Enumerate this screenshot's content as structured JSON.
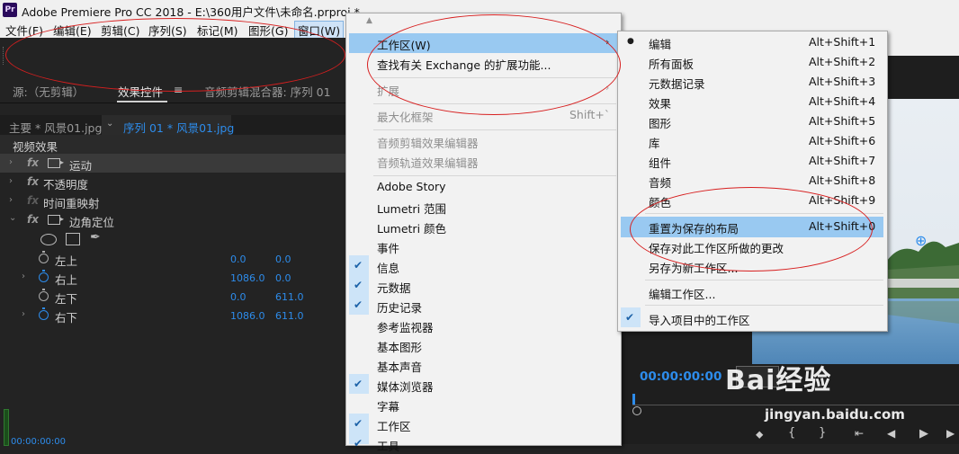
{
  "app": {
    "logo": "Pr",
    "title": "Adobe Premiere Pro CC 2018 - E:\\360用户文件\\未命名.prproj *"
  },
  "menubar": [
    {
      "label": "文件(F)"
    },
    {
      "label": "编辑(E)"
    },
    {
      "label": "剪辑(C)"
    },
    {
      "label": "序列(S)"
    },
    {
      "label": "标记(M)"
    },
    {
      "label": "图形(G)"
    },
    {
      "label": "窗口(W)"
    }
  ],
  "panel_tabs": {
    "source": "源:（无剪辑）",
    "effect_controls": "效果控件",
    "menu_glyph": "≡",
    "audio_mixer": "音频剪辑混合器: 序列 01"
  },
  "sequence_bar": {
    "master": "主要 * 风景01.jpg",
    "sequence": "序列 01 * 风景01.jpg"
  },
  "effects_panel": {
    "section": "视频效果",
    "effects": [
      {
        "label": "运动"
      },
      {
        "label": "不透明度"
      },
      {
        "label": "时间重映射"
      },
      {
        "label": "边角定位"
      }
    ],
    "params": [
      {
        "label": "左上",
        "v1": "0.0",
        "v2": "0.0"
      },
      {
        "label": "右上",
        "v1": "1086.0",
        "v2": "0.0"
      },
      {
        "label": "左下",
        "v1": "0.0",
        "v2": "611.0"
      },
      {
        "label": "右下",
        "v1": "1086.0",
        "v2": "611.0"
      }
    ],
    "bottom_timecode": "00:00:00:00"
  },
  "window_menu": {
    "items": [
      {
        "label": "工作区(W)",
        "state": "highlighted"
      },
      {
        "label": "查找有关 Exchange 的扩展功能..."
      },
      {
        "label": "扩展",
        "state": "disabled"
      },
      {
        "label": "最大化框架",
        "state": "disabled",
        "shortcut": "Shift+`"
      },
      {
        "label": "音频剪辑效果编辑器",
        "state": "disabled"
      },
      {
        "label": "音频轨道效果编辑器",
        "state": "disabled"
      },
      {
        "label": "Adobe Story"
      },
      {
        "label": "Lumetri 范围"
      },
      {
        "label": "Lumetri 颜色"
      },
      {
        "label": "事件"
      },
      {
        "label": "信息",
        "checked": true
      },
      {
        "label": "元数据",
        "checked": true
      },
      {
        "label": "历史记录",
        "checked": true
      },
      {
        "label": "参考监视器"
      },
      {
        "label": "基本图形"
      },
      {
        "label": "基本声音"
      },
      {
        "label": "媒体浏览器",
        "checked": true
      },
      {
        "label": "字幕"
      },
      {
        "label": "工作区",
        "checked": true
      },
      {
        "label": "工具",
        "checked": true
      }
    ]
  },
  "workspace_submenu": {
    "items": [
      {
        "label": "编辑",
        "shortcut": "Alt+Shift+1",
        "current": true
      },
      {
        "label": "所有面板",
        "shortcut": "Alt+Shift+2"
      },
      {
        "label": "元数据记录",
        "shortcut": "Alt+Shift+3"
      },
      {
        "label": "效果",
        "shortcut": "Alt+Shift+4"
      },
      {
        "label": "图形",
        "shortcut": "Alt+Shift+5"
      },
      {
        "label": "库",
        "shortcut": "Alt+Shift+6"
      },
      {
        "label": "组件",
        "shortcut": "Alt+Shift+7"
      },
      {
        "label": "音频",
        "shortcut": "Alt+Shift+8"
      },
      {
        "label": "颜色",
        "shortcut": "Alt+Shift+9"
      },
      {
        "label": "重置为保存的布局",
        "shortcut": "Alt+Shift+0",
        "state": "highlighted"
      },
      {
        "label": "保存对此工作区所做的更改"
      },
      {
        "label": "另存为新工作区..."
      },
      {
        "label": "编辑工作区..."
      },
      {
        "label": "导入项目中的工作区",
        "checked": true
      }
    ]
  },
  "monitor": {
    "timecode": "00:00:00:00"
  },
  "watermark": {
    "brand": "Bai经验",
    "url": "jingyan.baidu.com"
  },
  "colors": {
    "accent_blue": "#2d8ceb",
    "menu_highlight": "#99c9f1",
    "annotation_red": "#d71f1f"
  }
}
